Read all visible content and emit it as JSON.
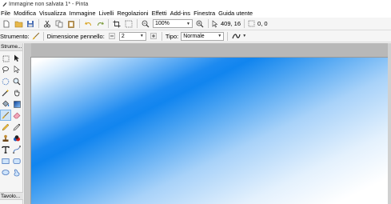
{
  "window": {
    "title": "Immagine non salvata 1* - Pinta"
  },
  "menubar": {
    "items": [
      "File",
      "Modifica",
      "Visualizza",
      "Immagine",
      "Livelli",
      "Regolazioni",
      "Effetti",
      "Add-ins",
      "Finestra",
      "Guida utente"
    ]
  },
  "toolbar": {
    "zoom": "100%",
    "cursor_position": "409, 16",
    "selection_size": "0, 0"
  },
  "tool_options": {
    "tool_label": "Strumento:",
    "brush_width_label": "Dimensione pennello:",
    "brush_width": "2",
    "type_label": "Tipo:",
    "type_value": "Normale"
  },
  "tools_panel": {
    "header": "Strume..."
  },
  "palette_panel": {
    "header": "Tavolo..."
  },
  "canvas": {
    "gradient_colors": [
      "#ffffff",
      "#1185ef",
      "#ffffff"
    ]
  }
}
